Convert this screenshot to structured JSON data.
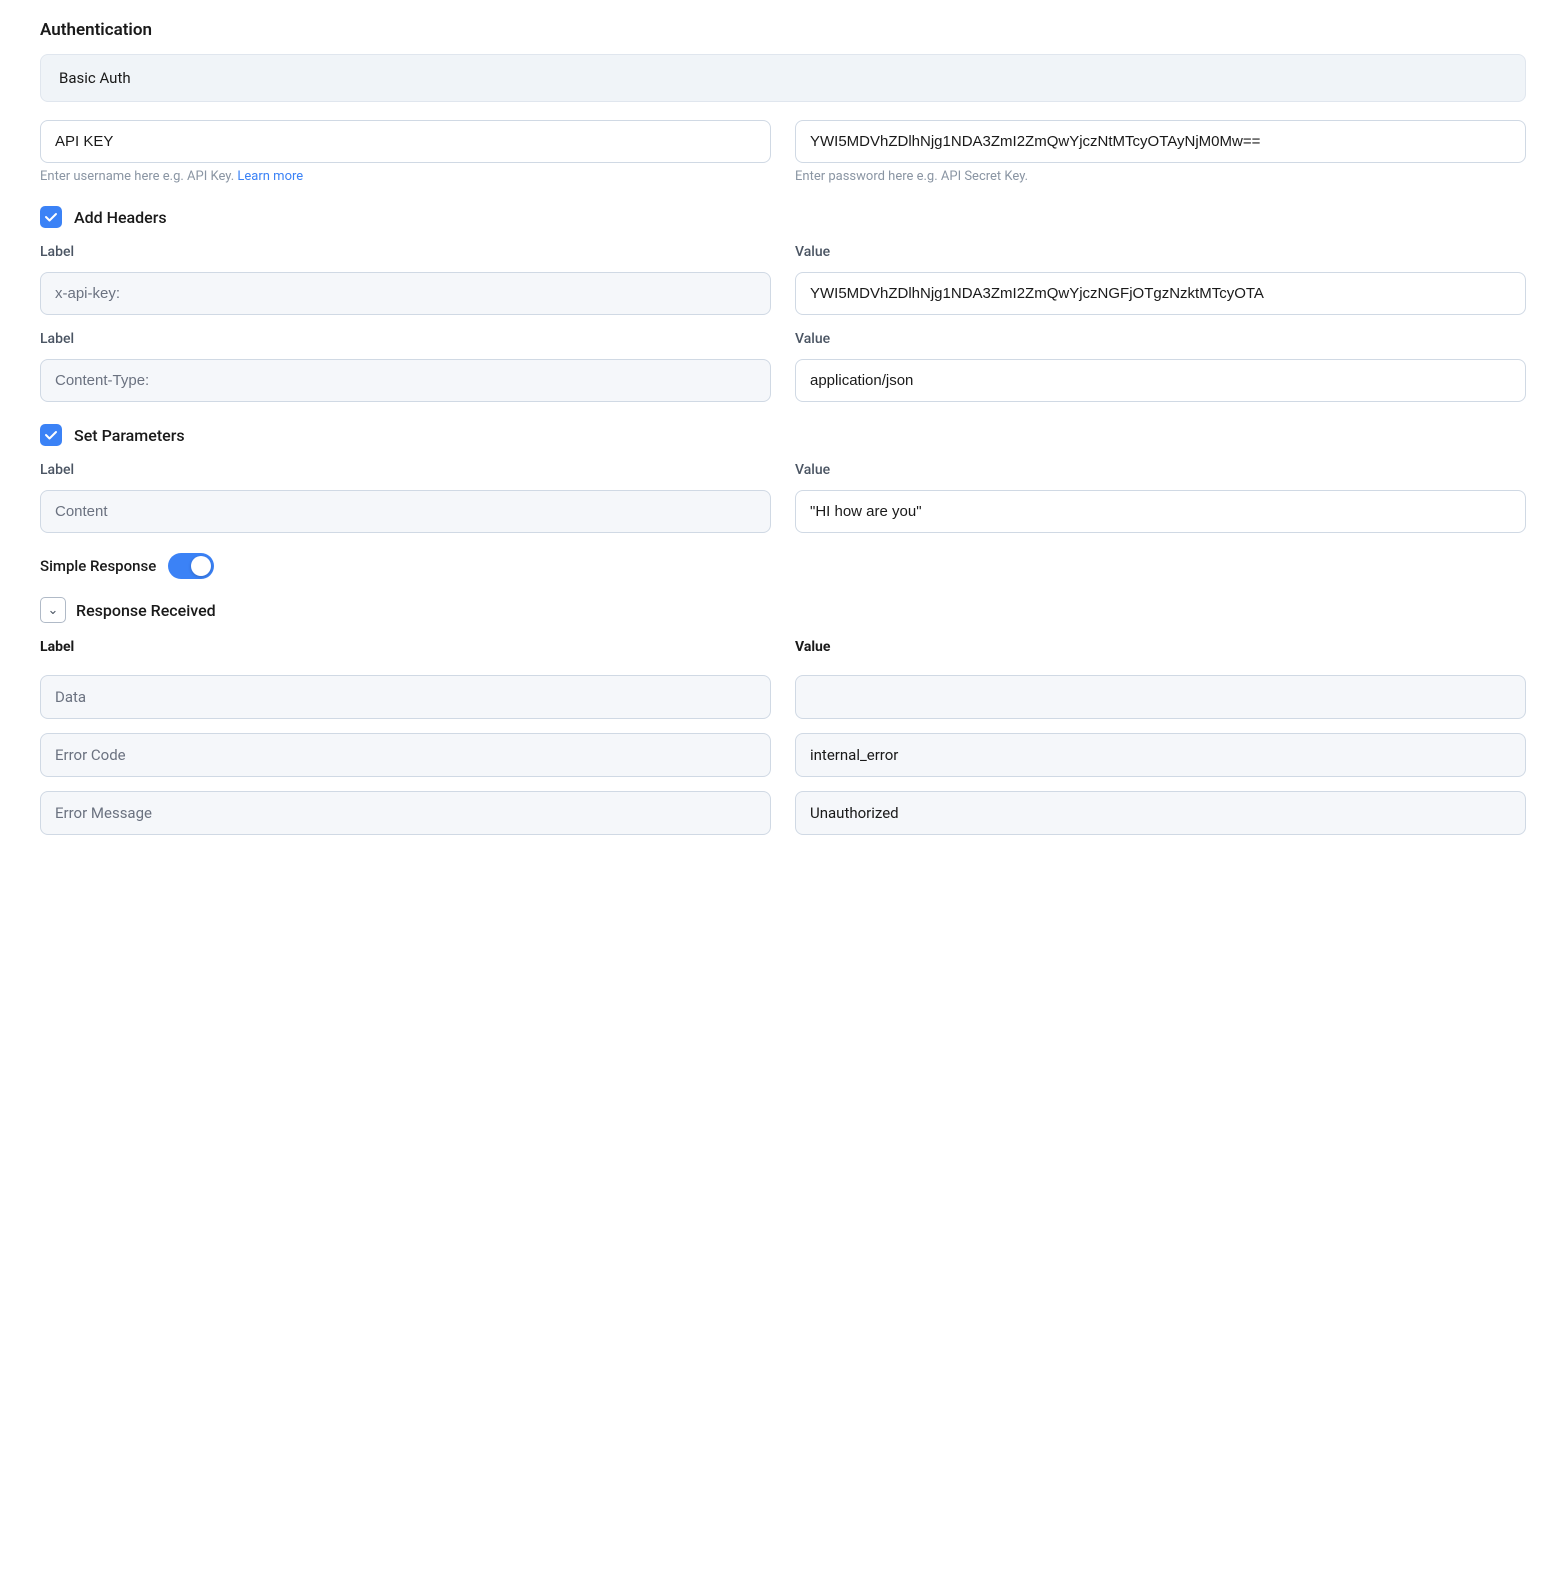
{
  "page": {
    "background": "#ffffff"
  },
  "authentication": {
    "section_title": "Authentication",
    "auth_type": "Basic Auth",
    "api_key_label": "API KEY",
    "api_key_placeholder": "API KEY",
    "api_key_hint": "Enter username here e.g. API Key.",
    "api_key_learn_more": "Learn more",
    "api_key_value": "API KEY",
    "password_value": "YWI5MDVhZDlhNjg1NDA3ZmI2ZmQwYjczNtMTcyOTAyNjM0Mw==",
    "password_hint": "Enter password here e.g. API Secret Key."
  },
  "add_headers": {
    "checkbox_label": "Add Headers",
    "checked": true,
    "rows": [
      {
        "label_col": "Label",
        "value_col": "Value",
        "label_value": "x-api-key:",
        "field_value": "YWI5MDVhZDlhNjg1NDA3ZmI2ZmQwYjczNGFjOTgzNzktMTcyOTA"
      },
      {
        "label_col": "Label",
        "value_col": "Value",
        "label_value": "Content-Type:",
        "field_value": "application/json"
      }
    ]
  },
  "set_parameters": {
    "checkbox_label": "Set Parameters",
    "checked": true,
    "rows": [
      {
        "label_col": "Label",
        "value_col": "Value",
        "label_value": "Content",
        "field_value": "\"HI how are you\""
      }
    ]
  },
  "simple_response": {
    "label": "Simple Response",
    "enabled": true
  },
  "response_received": {
    "collapse_label": "Response Received",
    "label_header": "Label",
    "value_header": "Value",
    "rows": [
      {
        "label": "Data",
        "value": "",
        "value_empty": true
      },
      {
        "label": "Error Code",
        "value": "internal_error",
        "value_empty": false
      },
      {
        "label": "Error Message",
        "value": "Unauthorized",
        "value_empty": false
      }
    ]
  },
  "icons": {
    "check": "✓",
    "chevron_down": "∨"
  }
}
